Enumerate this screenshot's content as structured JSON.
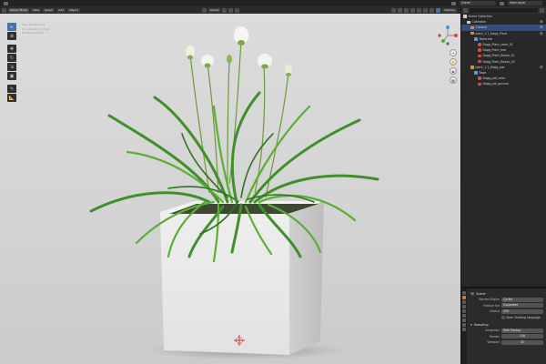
{
  "topbar": {
    "scene_label": "Scene",
    "view_layer_label": "View Layer"
  },
  "viewport": {
    "mode": "Object Mode",
    "menus": [
      "View",
      "Select",
      "Add",
      "Object"
    ],
    "orientation": "Global",
    "options_label": "Options",
    "info_lines": [
      "User Perspective",
      "(1) Collection | Plant",
      "Rendering Done"
    ]
  },
  "toolbar": {
    "tools": [
      "select-box",
      "cursor",
      "move",
      "rotate",
      "scale",
      "transform",
      "annotate",
      "measure"
    ]
  },
  "outliner": {
    "header_title": "Scene Collection",
    "rows": [
      {
        "label": "Scene Collection",
        "icon": "col",
        "indent": 0,
        "selected": false
      },
      {
        "label": "Collection",
        "icon": "col",
        "indent": 1,
        "selected": false
      },
      {
        "label": "Camera",
        "icon": "obj",
        "indent": 2,
        "selected": true
      },
      {
        "label": "plant_1.1_Dagg_Plant",
        "icon": "obj",
        "indent": 2,
        "selected": false
      },
      {
        "label": "Materials",
        "icon": "mod",
        "indent": 3,
        "selected": false
      },
      {
        "label": "Dagg_Plant_stem_01",
        "icon": "mat",
        "indent": 4,
        "selected": false
      },
      {
        "label": "Dagg_Plant_leaf",
        "icon": "mat",
        "indent": 4,
        "selected": false
      },
      {
        "label": "Dagg_Plant_flower_01",
        "icon": "mat",
        "indent": 4,
        "selected": false
      },
      {
        "label": "Dagg_Plant_flower_02",
        "icon": "mat",
        "indent": 4,
        "selected": false
      },
      {
        "label": "plant_1.1_Dagg_pot",
        "icon": "obj",
        "indent": 2,
        "selected": false
      },
      {
        "label": "Base",
        "icon": "mod",
        "indent": 3,
        "selected": false
      },
      {
        "label": "Dagg_pot_color",
        "icon": "mat",
        "indent": 4,
        "selected": false
      },
      {
        "label": "Dagg_pot_ground",
        "icon": "mat",
        "indent": 4,
        "selected": false
      }
    ]
  },
  "properties": {
    "header": "Scene",
    "render_engine_label": "Render Engine",
    "render_engine": "Cycles",
    "feature_set_label": "Feature Set",
    "feature_set": "Supported",
    "device_label": "Device",
    "device": "CPU",
    "osl_label": "Open Shading Language",
    "sampling_label": "Sampling",
    "integrator_label": "Integrator",
    "integrator": "Path Tracing",
    "render_label": "Render",
    "render_samples": "128",
    "viewport_label": "Viewport",
    "viewport_samples": "32"
  }
}
